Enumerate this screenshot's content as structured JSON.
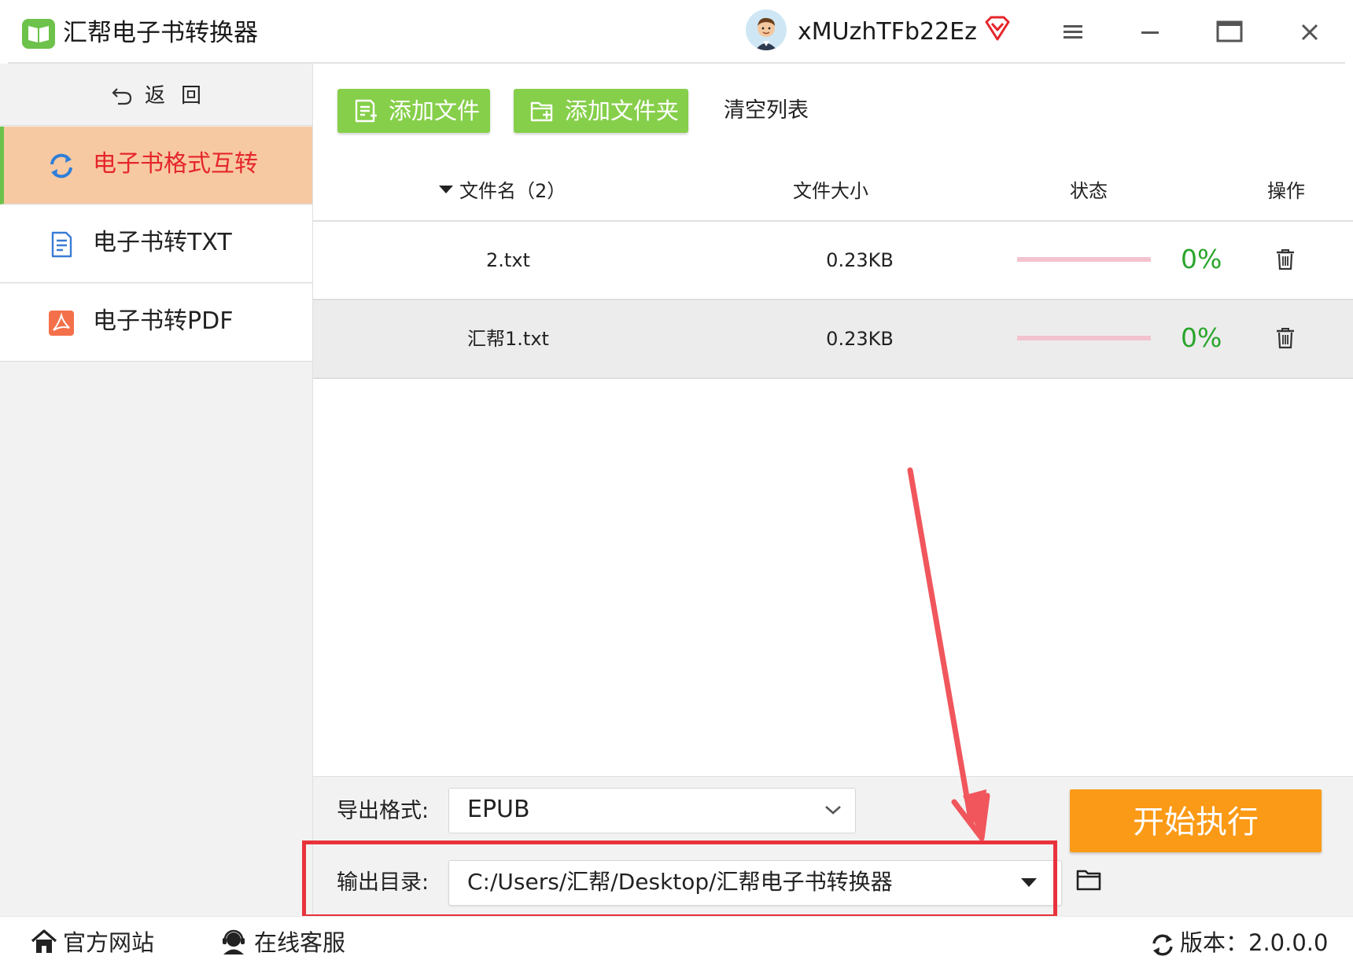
{
  "titlebar": {
    "app_title": "汇帮电子书转换器",
    "username": "xMUzhTFb22Ez",
    "icons": [
      "book-logo-icon",
      "avatar",
      "vip-diamond-icon",
      "hamburger-menu-icon",
      "minimize-icon",
      "maximize-icon",
      "close-icon"
    ]
  },
  "sidebar": {
    "back_label": "返回",
    "items": [
      {
        "label": "电子书格式互转",
        "icon": "refresh-arrows-icon",
        "active": true
      },
      {
        "label": "电子书转TXT",
        "icon": "document-icon",
        "active": false
      },
      {
        "label": "电子书转PDF",
        "icon": "pdf-icon",
        "active": false
      }
    ]
  },
  "toolbar": {
    "add_file_label": "添加文件",
    "add_folder_label": "添加文件夹",
    "clear_list_label": "清空列表"
  },
  "table": {
    "headers": {
      "name": "文件名（2）",
      "size": "文件大小",
      "status": "状态",
      "action": "操作"
    },
    "rows": [
      {
        "name": "2.txt",
        "size": "0.23KB",
        "progress": "0%"
      },
      {
        "name": "汇帮1.txt",
        "size": "0.23KB",
        "progress": "0%"
      }
    ]
  },
  "options": {
    "format_label": "导出格式:",
    "format_value": "EPUB",
    "dir_label": "输出目录:",
    "dir_value": "C:/Users/汇帮/Desktop/汇帮电子书转换器",
    "start_label": "开始执行"
  },
  "footer": {
    "website_label": "官方网站",
    "support_label": "在线客服",
    "version_label": "版本：2.0.0.0"
  },
  "colors": {
    "accent_green": "#86cf4a",
    "active_nav_bg": "#f7c9a2",
    "active_nav_text": "#e5262b",
    "start_orange": "#fb9a16",
    "percent_green": "#2aa52a",
    "annotation_red": "#e8333c"
  }
}
